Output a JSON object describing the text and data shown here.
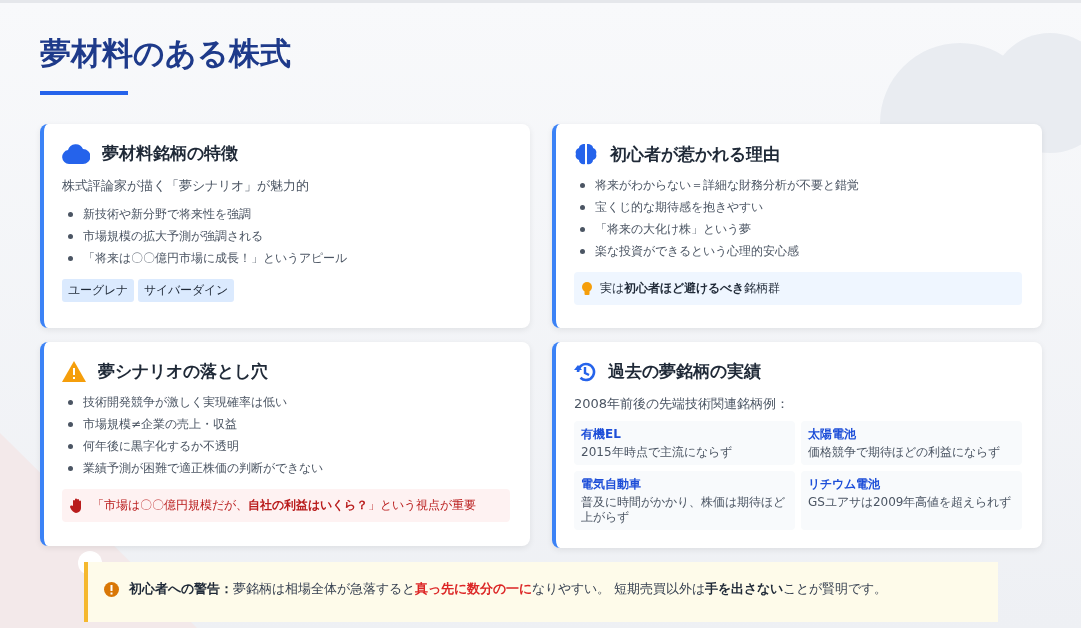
{
  "title": "夢材料のある株式",
  "cards": [
    {
      "title": "夢材料銘柄の特徴",
      "subtitle": "株式評論家が描く「夢シナリオ」が魅力的",
      "bullets": [
        "新技術や新分野で将来性を強調",
        "市場規模の拡大予測が強調される",
        "「将来は〇〇億円市場に成長！」というアピール"
      ],
      "tags": [
        "ユーグレナ",
        "サイバーダイン"
      ]
    },
    {
      "title": "初心者が惹かれる理由",
      "bullets": [
        "将来がわからない＝詳細な財務分析が不要と錯覚",
        "宝くじ的な期待感を抱きやすい",
        "「将来の大化け株」という夢",
        "楽な投資ができるという心理的安心感"
      ],
      "note": {
        "kind": "tip",
        "text": "実は**初心者ほど避けるべき**銘柄群"
      }
    },
    {
      "title": "夢シナリオの落とし穴",
      "bullets": [
        "技術開発競争が激しく実現確率は低い",
        "市場規模≠企業の売上・収益",
        "何年後に黒字化するか不透明",
        "業績予測が困難で適正株価の判断ができない"
      ],
      "note": {
        "kind": "alert",
        "text": "「市場は〇〇億円規模だが、**自社の利益はいくら？**」という視点が重要"
      }
    },
    {
      "title": "過去の夢銘柄の実績",
      "subtitle": "2008年前後の先端技術関連銘柄例：",
      "examples": [
        {
          "name": "有機EL",
          "desc": "2015年時点で主流にならず"
        },
        {
          "name": "太陽電池",
          "desc": "価格競争で期待ほどの利益にならず"
        },
        {
          "name": "電気自動車",
          "desc": "普及に時間がかかり、株価は期待ほど上がらず"
        },
        {
          "name": "リチウム電池",
          "desc": "GSユアサは2009年高値を超えられず"
        }
      ]
    }
  ],
  "warning": [
    {
      "kind": "bold",
      "text": "初心者への警告："
    },
    {
      "kind": "plain",
      "text": "夢銘柄は相場全体が急落すると"
    },
    {
      "kind": "red",
      "text": "真っ先に数分の一に"
    },
    {
      "kind": "plain",
      "text": "なりやすい。 短期売買以外は"
    },
    {
      "kind": "bold",
      "text": "手を出さない"
    },
    {
      "kind": "plain",
      "text": "ことが賢明です。"
    }
  ]
}
